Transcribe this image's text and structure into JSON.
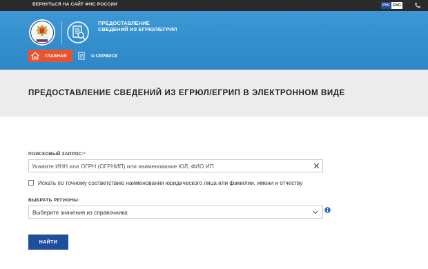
{
  "topbar": {
    "back_link": "Вернуться на сайт ФНС России",
    "lang_ru": "РУС",
    "lang_en": "ENG",
    "phone_icon": "phone-icon"
  },
  "header": {
    "emblem_icon": "fns-emblem-icon",
    "service_icon": "service-document-icon",
    "title": "Предоставление сведений из ЕГРЮЛ/ЕГРИП"
  },
  "nav": {
    "home_label": "Главная",
    "home_icon": "home-icon",
    "about_label": "О сервисе",
    "about_icon": "document-icon"
  },
  "page": {
    "title": "Предоставление сведений из ЕГРЮЛ/ЕГРИП в электронном виде"
  },
  "form": {
    "query_label": "Поисковый запрос:",
    "query_required_mark": "*",
    "query_placeholder": "Укажите ИНН или ОГРН (ОГРНИП) или наименование ЮЛ, ФИО ИП",
    "query_value": "",
    "exact_match_label": "Искать по точному соответствию наименования юридического лица или фамилии, имени и отчеству",
    "exact_match_checked": false,
    "region_label": "Выбрать регионы:",
    "region_value": "Выберите значения из справочника",
    "submit_label": "Найти"
  },
  "colors": {
    "topbar": "#2b2b2b",
    "header_blue": "#3390cc",
    "home_tab": "#e8542f",
    "title_band": "#ececec",
    "button": "#1f4f9a",
    "required": "#d9342b"
  }
}
